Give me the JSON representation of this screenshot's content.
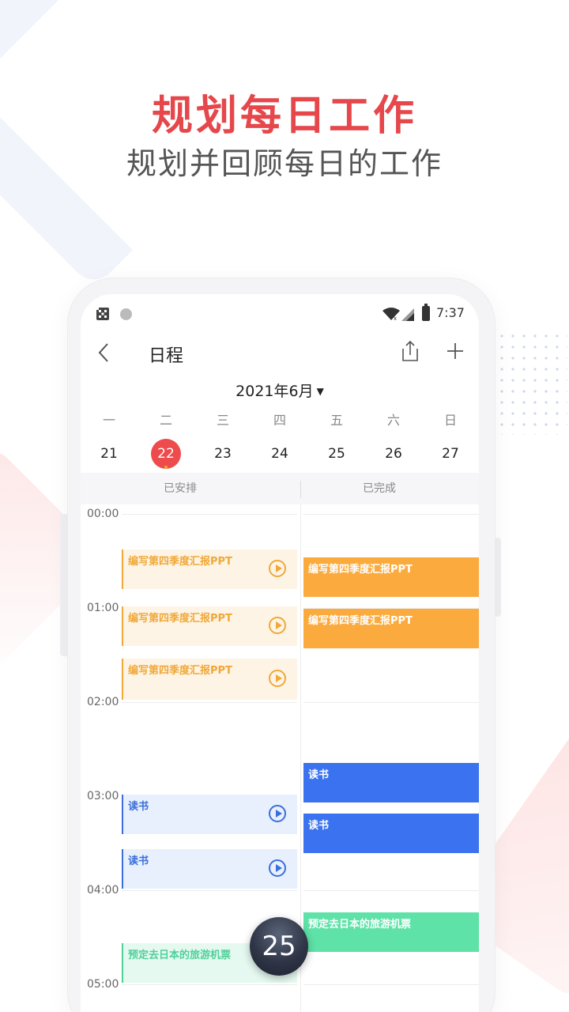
{
  "promo": {
    "headline": "规划每日工作",
    "subheadline": "规划并回顾每日的工作"
  },
  "status_bar": {
    "time": "7:37"
  },
  "app_bar": {
    "title": "日程"
  },
  "calendar": {
    "month_label": "2021年6月",
    "weekdays": [
      "一",
      "二",
      "三",
      "四",
      "五",
      "六",
      "日"
    ],
    "dates": [
      "21",
      "22",
      "23",
      "24",
      "25",
      "26",
      "27"
    ],
    "selected_date": "22",
    "accent_color": "#ee4c4c"
  },
  "columns": {
    "planned": "已安排",
    "completed": "已完成"
  },
  "timeline": {
    "hours": [
      "00:00",
      "01:00",
      "02:00",
      "03:00",
      "04:00",
      "05:00"
    ]
  },
  "planned_events": [
    {
      "title": "编写第四季度汇报PPT",
      "color": "orange"
    },
    {
      "title": "编写第四季度汇报PPT",
      "color": "orange"
    },
    {
      "title": "编写第四季度汇报PPT",
      "color": "orange"
    },
    {
      "title": "读书",
      "color": "blue"
    },
    {
      "title": "读书",
      "color": "blue"
    },
    {
      "title": "预定去日本的旅游机票",
      "color": "green"
    }
  ],
  "completed_events": [
    {
      "title": "编写第四季度汇报PPT",
      "color": "orange"
    },
    {
      "title": "编写第四季度汇报PPT",
      "color": "orange"
    },
    {
      "title": "读书",
      "color": "blue"
    },
    {
      "title": "读书",
      "color": "blue"
    },
    {
      "title": "预定去日本的旅游机票",
      "color": "green"
    }
  ],
  "floating_avatar": {
    "label": "25"
  }
}
